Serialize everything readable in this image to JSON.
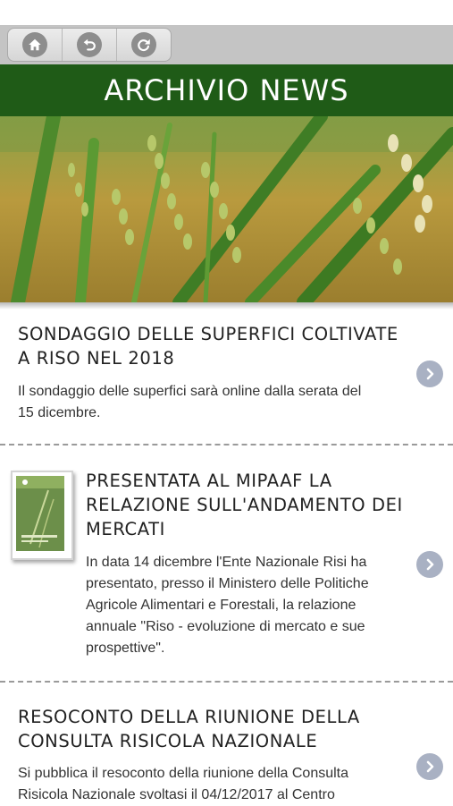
{
  "toolbar": {
    "buttons": [
      {
        "icon": "home-icon"
      },
      {
        "icon": "back-icon"
      },
      {
        "icon": "reload-icon"
      }
    ]
  },
  "page_title": "ARCHIVIO NEWS",
  "hero_image": "rice-plants",
  "colors": {
    "title_bar": "#1f5b17",
    "toolbar": "#c4c4c4",
    "chevron": "#a9b1c3"
  },
  "news": [
    {
      "title_lines": [
        "SONDAGGIO DELLE SUPERFICI COLTIVATE",
        "A RISO NEL 2018"
      ],
      "text_lines": [
        "Il sondaggio delle superfici sarà online dalla serata del",
        "15 dicembre."
      ]
    },
    {
      "title_lines": [
        "PRESENTATA AL MIPAAF LA",
        "RELAZIONE SULL'ANDAMENTO DEI",
        "MERCATI"
      ],
      "text_lines": [
        "In data 14 dicembre l'Ente Nazionale Risi ha",
        "presentato, presso il Ministero delle Politiche",
        "Agricole Alimentari e Forestali, la relazione",
        "annuale \"Riso - evoluzione di mercato e sue",
        "prospettive\"."
      ]
    },
    {
      "title_lines": [
        "RESOCONTO DELLA RIUNIONE DELLA",
        "CONSULTA RISICOLA NAZIONALE"
      ],
      "text_lines": [
        "Si pubblica il resoconto della riunione della Consulta",
        "Risicola Nazionale svoltasi il 04/12/2017 al Centro"
      ]
    }
  ]
}
